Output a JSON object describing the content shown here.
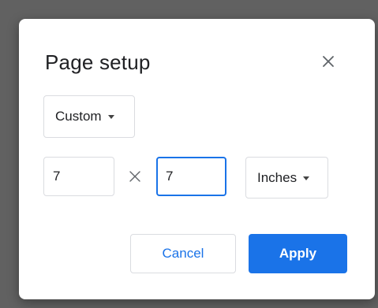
{
  "dialog": {
    "title": "Page setup",
    "close_icon": "close-icon",
    "preset": {
      "selected": "Custom"
    },
    "width_value": "7",
    "height_value": "7",
    "times_icon": "times-icon",
    "units": {
      "selected": "Inches"
    },
    "cancel_label": "Cancel",
    "apply_label": "Apply"
  },
  "colors": {
    "backdrop": "#616161",
    "accent": "#1a73e8",
    "border": "#dadce0",
    "text": "#202124"
  }
}
